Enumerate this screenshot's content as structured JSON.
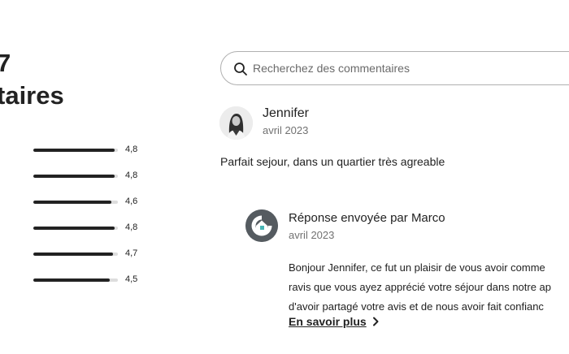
{
  "summary": {
    "heading_line1": "7",
    "heading_line2": "taires"
  },
  "ratings": [
    {
      "value": "4,8",
      "fill": 0.96
    },
    {
      "value": "4,8",
      "fill": 0.96
    },
    {
      "value": "4,6",
      "fill": 0.92
    },
    {
      "value": "4,8",
      "fill": 0.96
    },
    {
      "value": "4,7",
      "fill": 0.94
    },
    {
      "value": "4,5",
      "fill": 0.9
    }
  ],
  "search": {
    "placeholder": "Recherchez des commentaires",
    "icon": "search-icon"
  },
  "review": {
    "reviewer_name": "Jennifer",
    "date": "avril 2023",
    "text": "Parfait sejour, dans un quartier très agreable",
    "avatar_icon": "user-avatar"
  },
  "host_response": {
    "title": "Réponse envoyée par Marco",
    "date": "avril 2023",
    "body_lines": [
      "Bonjour Jennifer, ce fut un plaisir de vous avoir comme",
      "ravis que vous ayez apprécié votre séjour dans notre ap",
      "d'avoir partagé votre avis et de nous avoir fait confianc"
    ],
    "read_more_label": "En savoir plus",
    "logo_icon": "house-logo-icon",
    "logo_accent": "#48b5b5"
  },
  "colors": {
    "text": "#222222",
    "muted": "#717171",
    "bar_fill": "#222222",
    "bar_track": "#dddddd"
  }
}
